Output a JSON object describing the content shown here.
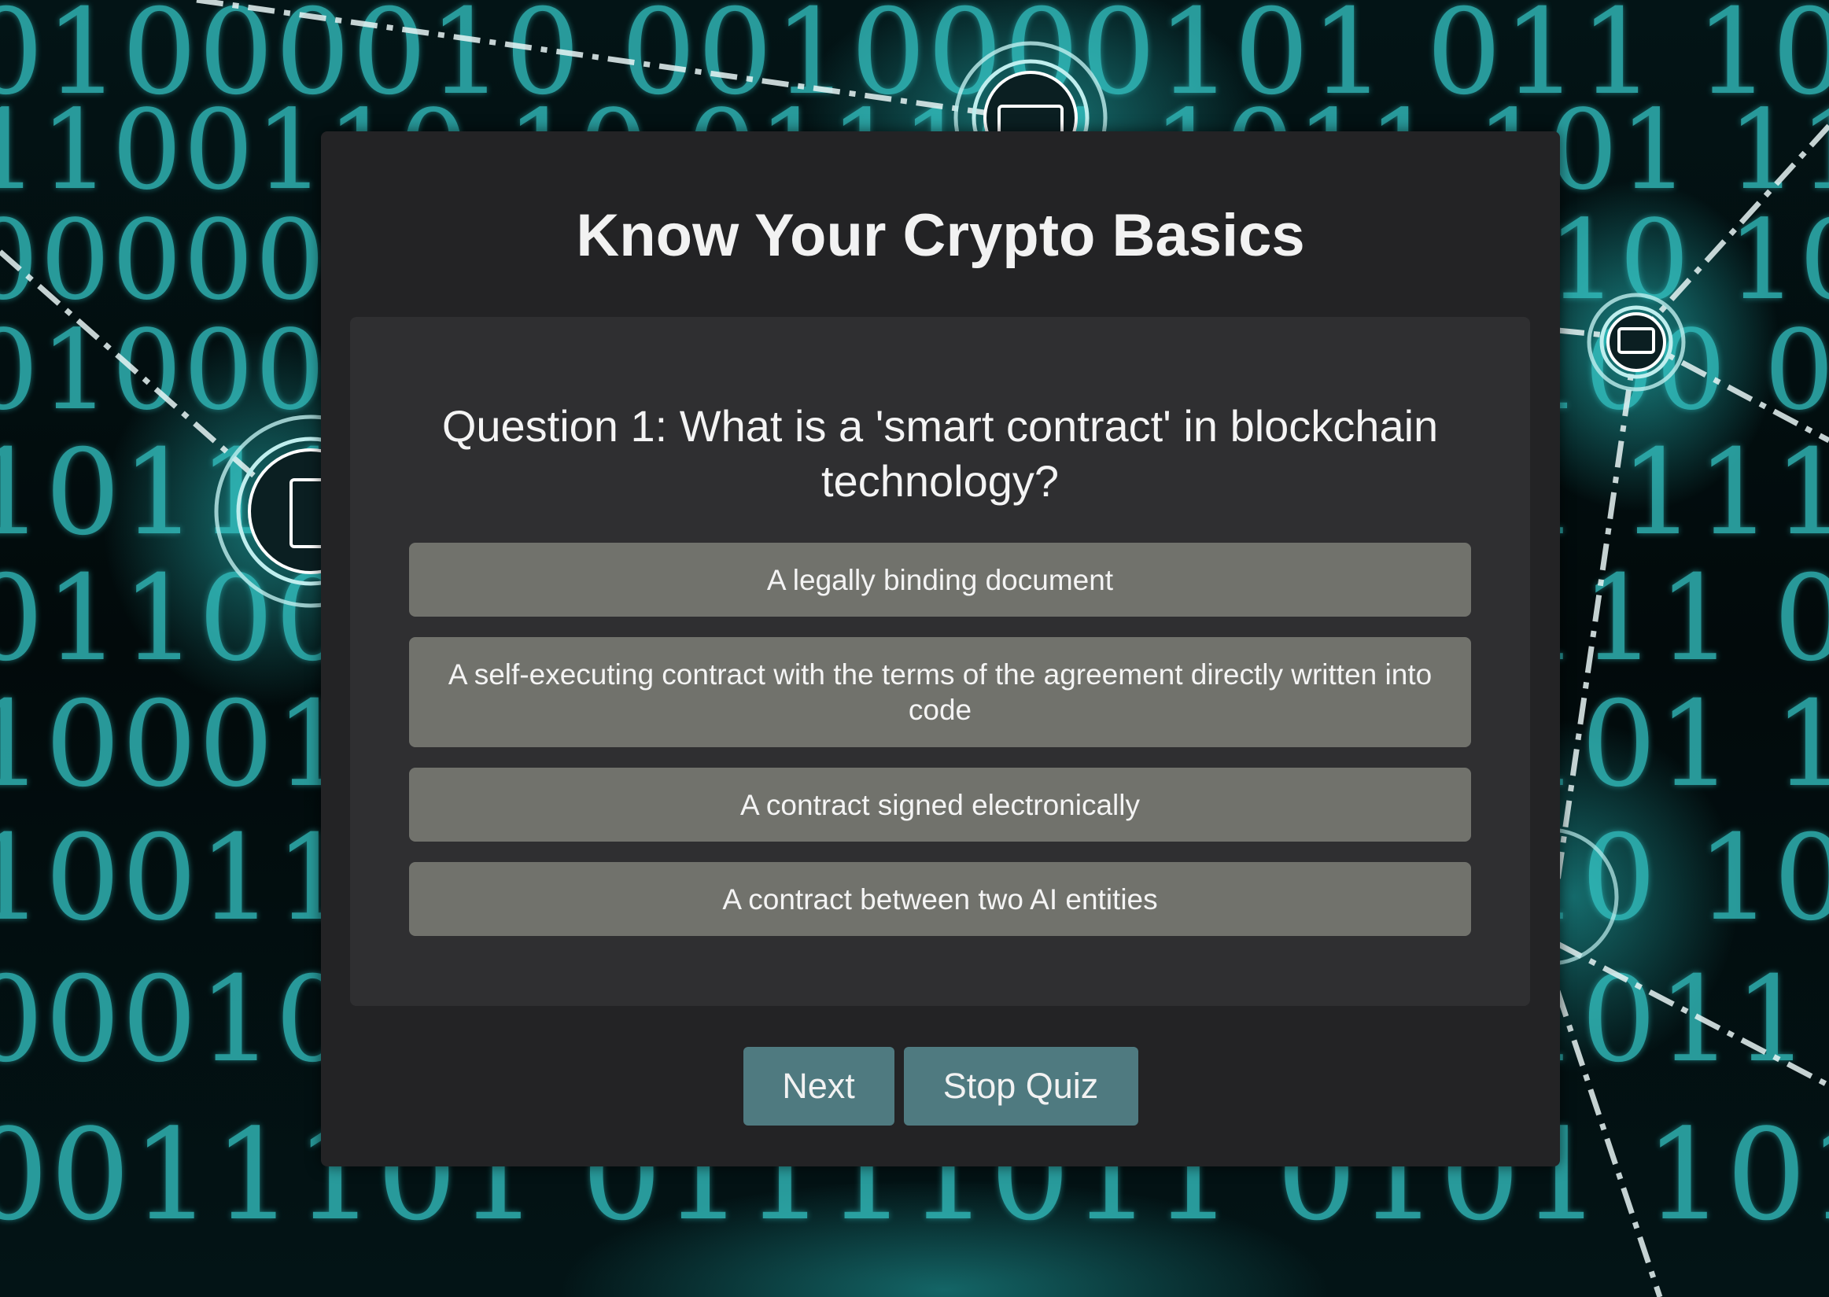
{
  "quiz": {
    "title": "Know Your Crypto Basics",
    "question": "Question 1: What is a 'smart contract' in blockchain technology?",
    "answers": [
      "A legally binding document",
      "A self-executing contract with the terms of the agreement directly written into code",
      "A contract signed electronically",
      "A contract between two AI entities"
    ],
    "next_label": "Next",
    "stop_label": "Stop Quiz"
  },
  "theme": {
    "panel_bg": "#232325",
    "card_bg": "#2f2f31",
    "answer_bg": "#71726c",
    "button_bg": "#4f7a80",
    "background_accent": "#35c8c8"
  }
}
